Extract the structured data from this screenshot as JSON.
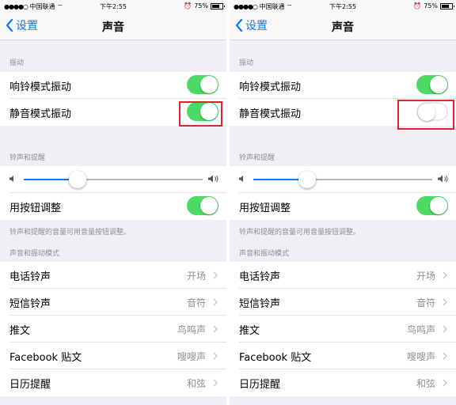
{
  "colors": {
    "accent": "#0a7bff",
    "toggle_on": "#4cd964",
    "highlight": "#e0242d"
  },
  "screens": [
    {
      "status": {
        "carrier": "中国联通 ⌔",
        "time": "下午2:55",
        "battery": "75%"
      },
      "nav": {
        "back_label": "设置",
        "title": "声音"
      },
      "vibrate": {
        "header": "振动",
        "rows": [
          {
            "label": "响铃模式振动",
            "on": true
          },
          {
            "label": "静音模式振动",
            "on": true
          }
        ]
      },
      "ringer": {
        "header": "铃声和提醒",
        "volume": 0.3,
        "adjust_label": "用按钮调整",
        "adjust_on": true,
        "footnote": "铃声和提醒的音量可用音量按钮调整。"
      },
      "patterns": {
        "header": "声音和振动模式",
        "rows": [
          {
            "label": "电话铃声",
            "value": "开场"
          },
          {
            "label": "短信铃声",
            "value": "音符"
          },
          {
            "label": "推文",
            "value": "鸟鸣声"
          },
          {
            "label": "Facebook 贴文",
            "value": "嗖嗖声"
          },
          {
            "label": "日历提醒",
            "value": "和弦"
          }
        ]
      }
    },
    {
      "status": {
        "carrier": "中国联通 ⌔",
        "time": "下午2:55",
        "battery": "75%"
      },
      "nav": {
        "back_label": "设置",
        "title": "声音"
      },
      "vibrate": {
        "header": "振动",
        "rows": [
          {
            "label": "响铃模式振动",
            "on": true
          },
          {
            "label": "静音模式振动",
            "on": false
          }
        ]
      },
      "ringer": {
        "header": "铃声和提醒",
        "volume": 0.3,
        "adjust_label": "用按钮调整",
        "adjust_on": true,
        "footnote": "铃声和提醒的音量可用音量按钮调整。"
      },
      "patterns": {
        "header": "声音和振动模式",
        "rows": [
          {
            "label": "电话铃声",
            "value": "开场"
          },
          {
            "label": "短信铃声",
            "value": "音符"
          },
          {
            "label": "推文",
            "value": "鸟鸣声"
          },
          {
            "label": "Facebook 贴文",
            "value": "嗖嗖声"
          },
          {
            "label": "日历提醒",
            "value": "和弦"
          }
        ]
      }
    }
  ]
}
